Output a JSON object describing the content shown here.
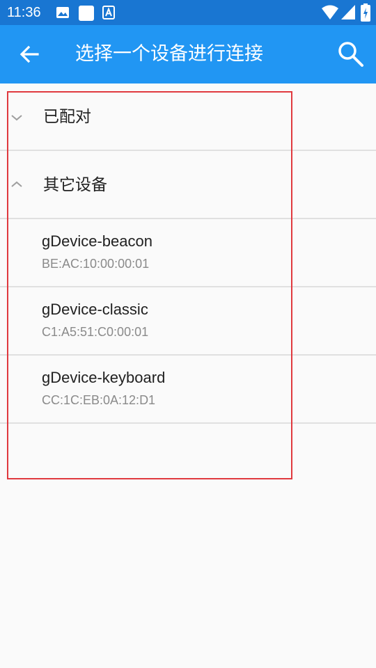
{
  "status_bar": {
    "time": "11:36",
    "icons": [
      "image-icon",
      "square-icon",
      "a-icon",
      "wifi-icon",
      "signal-icon",
      "battery-icon"
    ]
  },
  "app_bar": {
    "title": "选择一个设备进行连接",
    "back_icon": "arrow-left-icon",
    "search_icon": "search-icon",
    "color": "#2196f3"
  },
  "groups": [
    {
      "label": "已配对",
      "expanded": false
    },
    {
      "label": "其它设备",
      "expanded": true
    }
  ],
  "devices": [
    {
      "name": "gDevice-beacon",
      "mac": "BE:AC:10:00:00:01"
    },
    {
      "name": "gDevice-classic",
      "mac": "C1:A5:51:C0:00:01"
    },
    {
      "name": "gDevice-keyboard",
      "mac": "CC:1C:EB:0A:12:D1"
    }
  ],
  "highlight_color": "#e0393e"
}
